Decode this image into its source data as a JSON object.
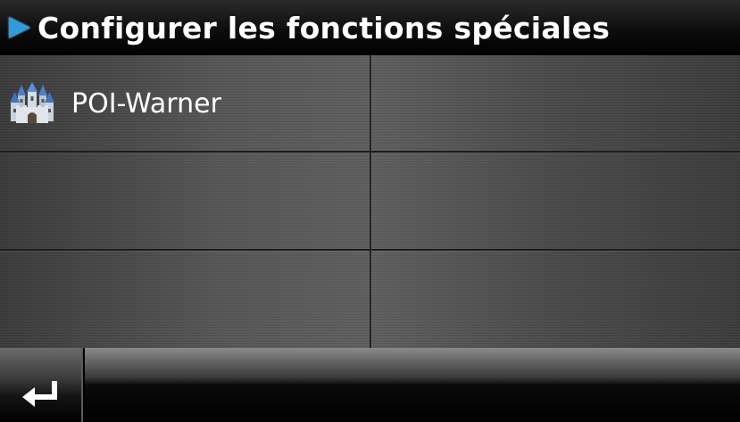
{
  "header": {
    "title": "Configurer les fonctions spéciales",
    "arrow_icon": "play-arrow-icon",
    "arrow_color": "#2f9bdc"
  },
  "menu": {
    "items": [
      {
        "label": "POI-Warner",
        "icon": "castle-icon"
      }
    ]
  },
  "footer": {
    "back_icon": "return-arrow-icon"
  }
}
